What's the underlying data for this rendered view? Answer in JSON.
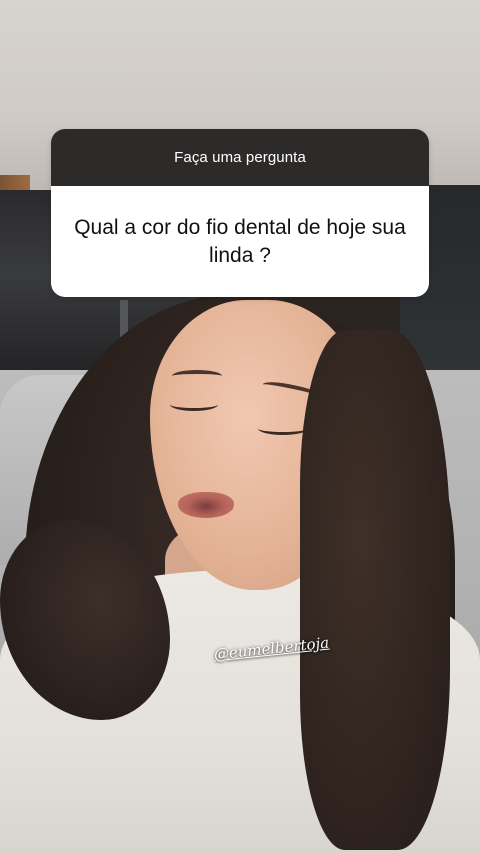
{
  "question_sticker": {
    "prompt": "Faça uma pergunta",
    "question": "Qual a cor do fio dental de hoje sua linda ?"
  },
  "mention_sticker": {
    "handle": "@eumelbertoja"
  },
  "colors": {
    "sticker_header": "#2d2a2a",
    "sticker_body": "#ffffff",
    "prompt_text": "#ffffff",
    "question_text": "#111111"
  }
}
